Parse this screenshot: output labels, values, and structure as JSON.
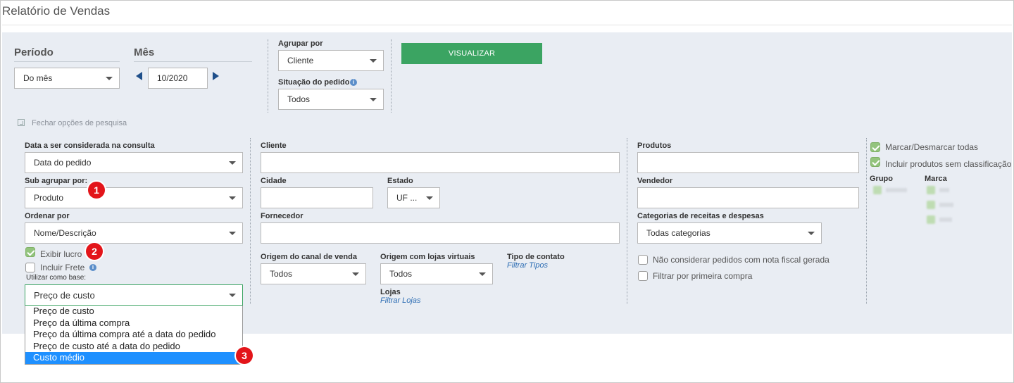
{
  "page": {
    "title": "Relatório de Vendas"
  },
  "top": {
    "periodo_label": "Período",
    "periodo_value": "Do mês",
    "mes_label": "Mês",
    "mes_value": "10/2020",
    "agrupar_label": "Agrupar por",
    "agrupar_value": "Cliente",
    "situacao_label": "Situação do pedido",
    "situacao_value": "Todos",
    "visualizar_label": "VISUALIZAR",
    "fechar_label": "Fechar opções de pesquisa"
  },
  "col1": {
    "data_label": "Data a ser considerada na consulta",
    "data_value": "Data do pedido",
    "sub_label": "Sub agrupar por:",
    "sub_value": "Produto",
    "ordenar_label": "Ordenar por",
    "ordenar_value": "Nome/Descrição",
    "exibir_lucro": "Exibir lucro",
    "incluir_frete": "Incluir Frete",
    "utilizar_label": "Utilizar como base:",
    "utilizar_value": "Preço de custo",
    "options": [
      "Preço de custo",
      "Preço da última compra",
      "Preço da última compra até a data do pedido",
      "Preço de custo até a data do pedido",
      "Custo médio"
    ]
  },
  "col2": {
    "cliente_label": "Cliente",
    "cliente_value": "",
    "cidade_label": "Cidade",
    "cidade_value": "",
    "estado_label": "Estado",
    "estado_value": "UF ...",
    "fornecedor_label": "Fornecedor",
    "fornecedor_value": "",
    "origem_canal_label": "Origem do canal de venda",
    "origem_canal_value": "Todos",
    "origem_lojas_label": "Origem com lojas virtuais",
    "origem_lojas_value": "Todos",
    "tipo_contato_label": "Tipo de contato",
    "filtrar_tipos": "Filtrar Tipos",
    "lojas_label": "Lojas",
    "filtrar_lojas": "Filtrar Lojas"
  },
  "col3": {
    "produtos_label": "Produtos",
    "produtos_value": "",
    "vendedor_label": "Vendedor",
    "vendedor_value": "",
    "categorias_label": "Categorias de receitas e despesas",
    "categorias_value": "Todas categorias",
    "nao_considerar": "Não considerar pedidos com nota fiscal gerada",
    "filtrar_primeira": "Filtrar por primeira compra"
  },
  "col4": {
    "marcar_todas": "Marcar/Desmarcar todas",
    "incluir_sem_class": "Incluir produtos sem classificação",
    "grupo_label": "Grupo",
    "marca_label": "Marca"
  },
  "badges": [
    "1",
    "2",
    "3"
  ],
  "colors": {
    "accent_green": "#3ba462",
    "highlight": "#1e90ff",
    "badge": "#e3151a",
    "panel": "#e9edf3"
  },
  "icons": [
    "chevron-down-icon",
    "arrow-left-icon",
    "arrow-right-icon",
    "info-icon",
    "check-icon",
    "collapse-icon"
  ]
}
